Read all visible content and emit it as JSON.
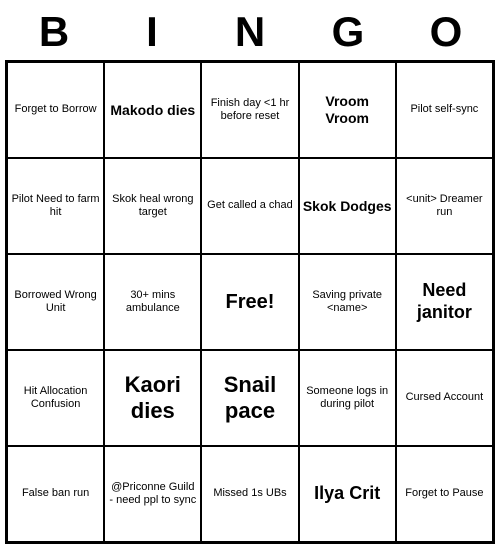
{
  "title": {
    "letters": [
      "B",
      "I",
      "N",
      "G",
      "O"
    ]
  },
  "cells": [
    {
      "text": "Forget to Borrow",
      "size": "normal"
    },
    {
      "text": "Makodo dies",
      "size": "medium"
    },
    {
      "text": "Finish day <1 hr before reset",
      "size": "small"
    },
    {
      "text": "Vroom Vroom",
      "size": "medium"
    },
    {
      "text": "Pilot self-sync",
      "size": "normal"
    },
    {
      "text": "Pilot Need to farm hit",
      "size": "normal"
    },
    {
      "text": "Skok heal wrong target",
      "size": "small"
    },
    {
      "text": "Get called a chad",
      "size": "normal"
    },
    {
      "text": "Skok Dodges",
      "size": "medium"
    },
    {
      "text": "<unit> Dreamer run",
      "size": "small"
    },
    {
      "text": "Borrowed Wrong Unit",
      "size": "normal"
    },
    {
      "text": "30+ mins ambulance",
      "size": "small"
    },
    {
      "text": "Free!",
      "size": "free"
    },
    {
      "text": "Saving private <name>",
      "size": "small"
    },
    {
      "text": "Need janitor",
      "size": "large"
    },
    {
      "text": "Hit Allocation Confusion",
      "size": "small"
    },
    {
      "text": "Kaori dies",
      "size": "xlarge"
    },
    {
      "text": "Snail pace",
      "size": "xlarge"
    },
    {
      "text": "Someone logs in during pilot",
      "size": "small"
    },
    {
      "text": "Cursed Account",
      "size": "normal"
    },
    {
      "text": "False ban run",
      "size": "normal"
    },
    {
      "text": "@Priconne Guild - need ppl to sync",
      "size": "small"
    },
    {
      "text": "Missed 1s UBs",
      "size": "normal"
    },
    {
      "text": "Ilya Crit",
      "size": "large"
    },
    {
      "text": "Forget to Pause",
      "size": "normal"
    }
  ]
}
